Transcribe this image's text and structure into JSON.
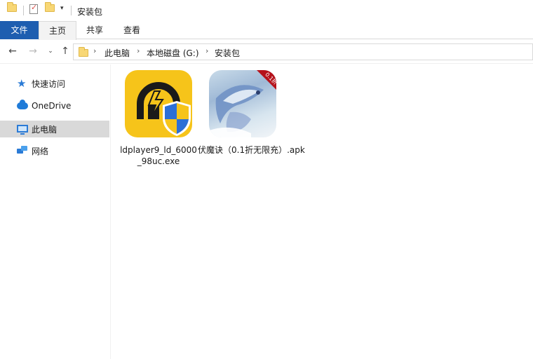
{
  "window": {
    "title": "安装包"
  },
  "ribbon": {
    "tabs": [
      "文件",
      "主页",
      "共享",
      "查看"
    ]
  },
  "address": {
    "breadcrumbs": [
      "此电脑",
      "本地磁盘 (G:)",
      "安装包"
    ]
  },
  "sidebar": {
    "items": [
      {
        "label": "快速访问",
        "icon": "star-icon"
      },
      {
        "label": "OneDrive",
        "icon": "cloud-icon"
      },
      {
        "label": "此电脑",
        "icon": "computer-icon",
        "selected": true
      },
      {
        "label": "网络",
        "icon": "network-icon"
      }
    ]
  },
  "files": [
    {
      "name": "ldplayer9_ld_6000_98uc.exe",
      "icon": "ldplayer-icon"
    },
    {
      "name": "伏魔诀（0.1折无限充）.apk",
      "icon": "game-apk-icon",
      "badge": "0.1折"
    }
  ],
  "colors": {
    "file_tab": "#1e5eb0",
    "selected_row": "#d9d9d9",
    "ld_yellow": "#f6c41a"
  }
}
